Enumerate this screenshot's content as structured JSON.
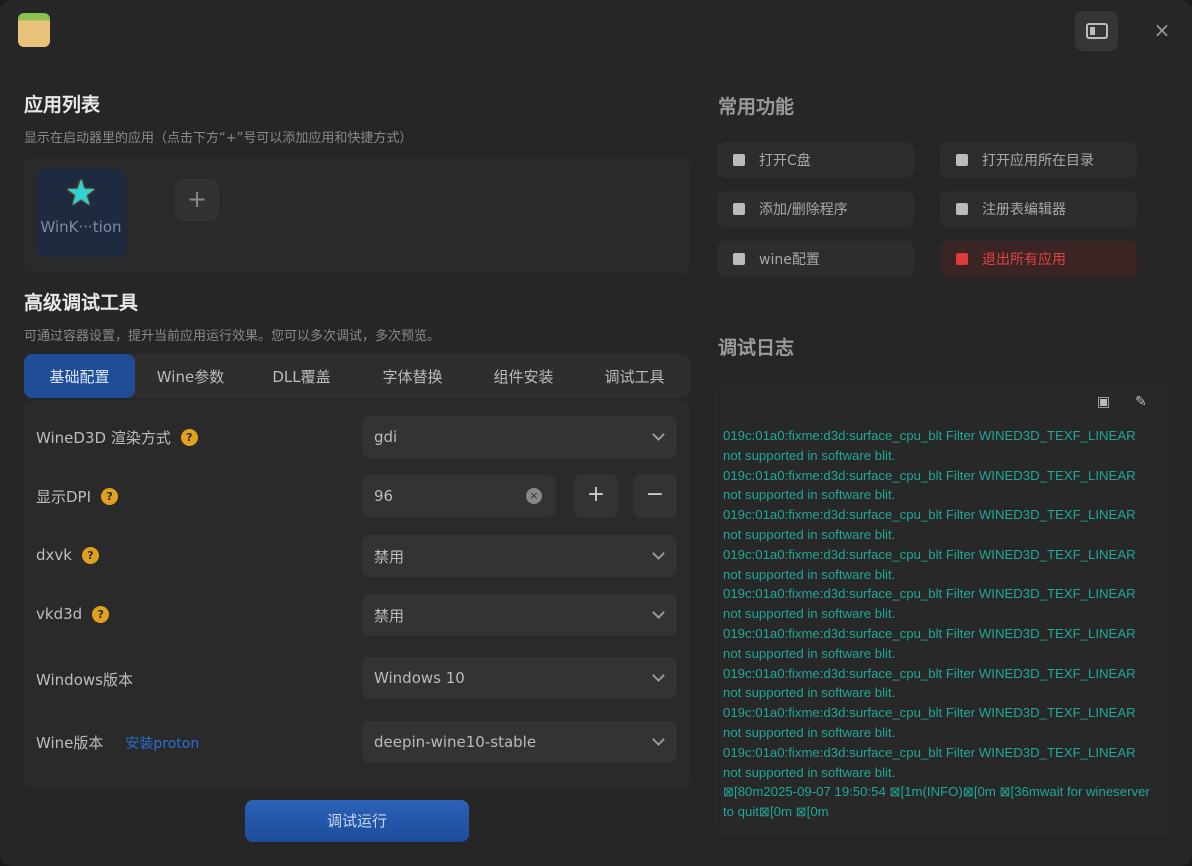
{
  "window": {
    "sidebar_toggle_icon": "sidebar-icon",
    "close_icon": "×"
  },
  "app_list": {
    "title": "应用列表",
    "subtitle": "显示在启动器里的应用（点击下方“+”号可以添加应用和快捷方式）",
    "apps": [
      {
        "name": "WinK···tion"
      }
    ],
    "add_label": "+"
  },
  "debug_tools": {
    "title": "高级调试工具",
    "subtitle": "可通过容器设置，提升当前应用运行效果。您可以多次调试，多次预览。",
    "tabs": [
      "基础配置",
      "Wine参数",
      "DLL覆盖",
      "字体替换",
      "组件安装",
      "调试工具"
    ],
    "active_tab": 0,
    "fields": {
      "wined3d": {
        "label": "WineD3D 渲染方式",
        "value": "gdi"
      },
      "dpi": {
        "label": "显示DPI",
        "value": "96",
        "plus": "+",
        "minus": "−"
      },
      "dxvk": {
        "label": "dxvk",
        "value": "禁用"
      },
      "vkd3d": {
        "label": "vkd3d",
        "value": "禁用"
      },
      "windows_version": {
        "label": "Windows版本",
        "value": "Windows 10"
      },
      "wine_version": {
        "label": "Wine版本",
        "link": "安装proton",
        "value": "deepin-wine10-stable"
      }
    },
    "help_mark": "?",
    "run_button": "调试运行"
  },
  "common": {
    "title": "常用功能",
    "buttons": [
      {
        "label": "打开C盘",
        "icon": "drive-icon"
      },
      {
        "label": "打开应用所在目录",
        "icon": "folder-grid-icon"
      },
      {
        "label": "添加/删除程序",
        "icon": "basket-icon"
      },
      {
        "label": "注册表编辑器",
        "icon": "registry-icon"
      },
      {
        "label": "wine配置",
        "icon": "wine-config-icon"
      },
      {
        "label": "退出所有应用",
        "icon": "exit-icon",
        "danger": true
      }
    ]
  },
  "log": {
    "title": "调试日志",
    "lines": [
      "019c:01a0:fixme:d3d:surface_cpu_blt Filter WINED3D_TEXF_LINEAR not supported in software blit.",
      "019c:01a0:fixme:d3d:surface_cpu_blt Filter WINED3D_TEXF_LINEAR not supported in software blit.",
      "019c:01a0:fixme:d3d:surface_cpu_blt Filter WINED3D_TEXF_LINEAR not supported in software blit.",
      "019c:01a0:fixme:d3d:surface_cpu_blt Filter WINED3D_TEXF_LINEAR not supported in software blit.",
      "019c:01a0:fixme:d3d:surface_cpu_blt Filter WINED3D_TEXF_LINEAR not supported in software blit.",
      "019c:01a0:fixme:d3d:surface_cpu_blt Filter WINED3D_TEXF_LINEAR not supported in software blit.",
      "019c:01a0:fixme:d3d:surface_cpu_blt Filter WINED3D_TEXF_LINEAR not supported in software blit.",
      "019c:01a0:fixme:d3d:surface_cpu_blt Filter WINED3D_TEXF_LINEAR not supported in software blit.",
      "019c:01a0:fixme:d3d:surface_cpu_blt Filter WINED3D_TEXF_LINEAR not supported in software blit.",
      "⊠[80m2025-09-07 19:50:54 ⊠[1m(INFO)⊠[0m ⊠[36mwait for wineserver to quit⊠[0m ⊠[0m"
    ],
    "color": "#1fa898"
  }
}
